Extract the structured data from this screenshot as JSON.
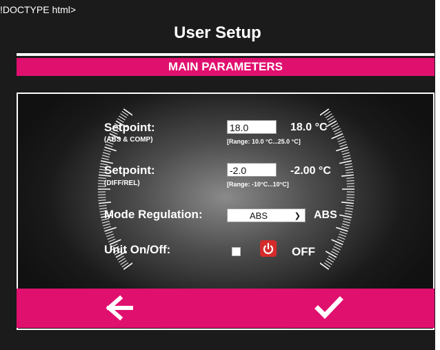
{
  "doctype_text": "!DOCTYPE html>",
  "page": {
    "title": "User Setup",
    "section_banner": "MAIN PARAMETERS"
  },
  "setpoint_abs": {
    "label": "Setpoint:",
    "sublabel": "(ABS & COMP)",
    "input_value": "18.0",
    "display_value": "18.0 °C",
    "range": "[Range: 10.0 °C...25.0 °C]"
  },
  "setpoint_diff": {
    "label": "Setpoint:",
    "sublabel": "(DIFF/REL)",
    "input_value": "-2.0",
    "display_value": "-2.00 °C",
    "range": "[Range: -10°C...10°C]"
  },
  "mode_regulation": {
    "label": "Mode Regulation:",
    "selected": "ABS",
    "display_value": "ABS"
  },
  "unit_onoff": {
    "label": "Unit On/Off:",
    "checked": false,
    "status": "OFF"
  },
  "icons": {
    "power": "power-icon",
    "back": "arrow-left-icon",
    "confirm": "checkmark-icon"
  },
  "colors": {
    "accent": "#e0106f",
    "background": "#1b1b1b",
    "power_button": "#d42b2b"
  }
}
